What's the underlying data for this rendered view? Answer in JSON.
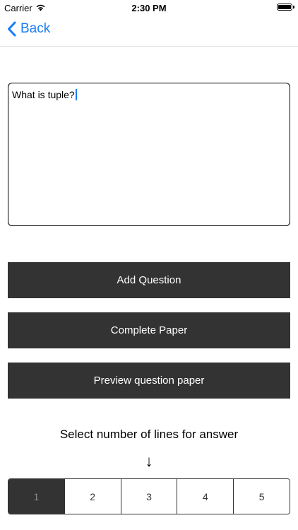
{
  "status_bar": {
    "carrier": "Carrier",
    "time": "2:30 PM"
  },
  "nav": {
    "back_label": "Back"
  },
  "question": {
    "text": "What is tuple?"
  },
  "buttons": {
    "add_question": "Add Question",
    "complete_paper": "Complete Paper",
    "preview_paper": "Preview question paper"
  },
  "lines_selector": {
    "label": "Select number of lines for answer",
    "arrow": "↓",
    "options": [
      "1",
      "2",
      "3",
      "4",
      "5"
    ],
    "selected": "1"
  },
  "colors": {
    "accent": "#1a7cf5",
    "button_bg": "#333333",
    "button_text": "#ffffff"
  },
  "icons": {
    "wifi": "wifi-icon",
    "battery": "battery-icon",
    "back": "chevron-left-icon"
  }
}
